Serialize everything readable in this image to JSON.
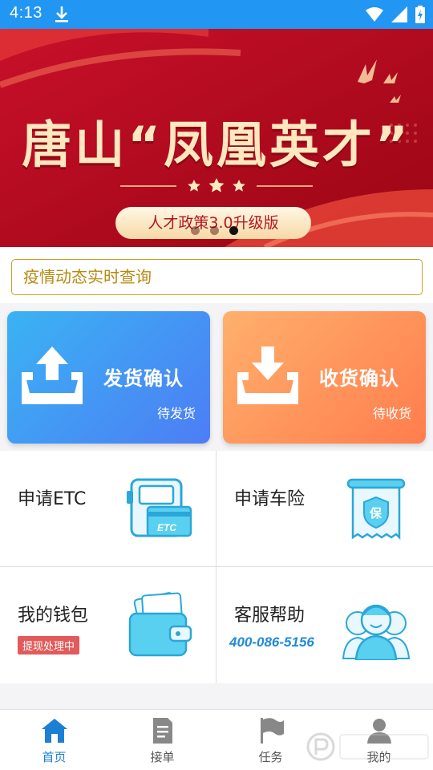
{
  "status_bar": {
    "time": "4:13"
  },
  "banner": {
    "title": "唐山“凤凰英才”",
    "pill_text": "人才政策3.0升级版",
    "slide_count": 3,
    "active_slide": 3
  },
  "search": {
    "placeholder": "疫情动态实时查询"
  },
  "actions": {
    "ship": {
      "label": "发货确认",
      "sub": "待发货"
    },
    "receive": {
      "label": "收货确认",
      "sub": "待收货"
    }
  },
  "services": {
    "etc": {
      "label": "申请ETC",
      "card_text": "ETC"
    },
    "insurance": {
      "label": "申请车险",
      "seal_text": "保"
    },
    "wallet": {
      "label": "我的钱包",
      "badge": "提现处理中"
    },
    "support": {
      "label": "客服帮助",
      "phone": "400-086-5156"
    }
  },
  "tabs": [
    {
      "label": "首页",
      "icon": "home-icon",
      "active": true
    },
    {
      "label": "接单",
      "icon": "document-icon",
      "active": false
    },
    {
      "label": "任务",
      "icon": "flag-icon",
      "active": false
    },
    {
      "label": "我的",
      "icon": "person-icon",
      "active": false
    }
  ],
  "colors": {
    "primary": "#2196f3",
    "tab_active": "#1c7fd6",
    "banner_red": "#b60a1c",
    "search_border": "#c9a227"
  }
}
